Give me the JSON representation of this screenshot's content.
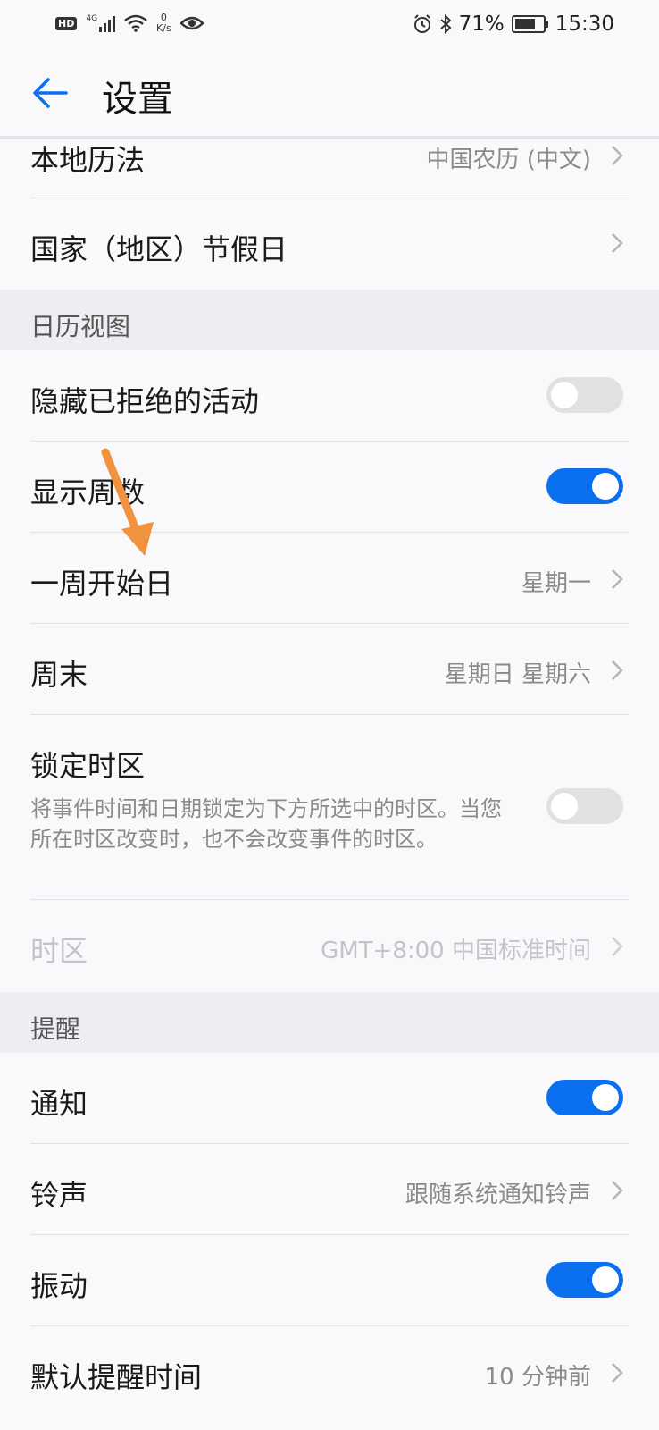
{
  "status_bar": {
    "hd": "HD",
    "network": "4G",
    "speed_value": "0",
    "speed_unit": "K/s",
    "battery": "71%",
    "time": "15:30"
  },
  "header": {
    "title": "设置"
  },
  "rows_top": [
    {
      "label": "本地历法",
      "value": "中国农历 (中文)"
    },
    {
      "label": "国家（地区）节假日",
      "value": ""
    }
  ],
  "section_calendar_view": {
    "title": "日历视图",
    "hide_declined": {
      "label": "隐藏已拒绝的活动",
      "on": false
    },
    "show_week_number": {
      "label": "显示周数",
      "on": true
    },
    "week_start": {
      "label": "一周开始日",
      "value": "星期一"
    },
    "weekend": {
      "label": "周末",
      "value": "星期日 星期六"
    },
    "lock_timezone": {
      "label": "锁定时区",
      "description": "将事件时间和日期锁定为下方所选中的时区。当您所在时区改变时，也不会改变事件的时区。",
      "on": false
    },
    "timezone": {
      "label": "时区",
      "value": "GMT+8:00 中国标准时间"
    }
  },
  "section_reminder": {
    "title": "提醒",
    "notification": {
      "label": "通知",
      "on": true
    },
    "ringtone": {
      "label": "铃声",
      "value": "跟随系统通知铃声"
    },
    "vibration": {
      "label": "振动",
      "on": true
    },
    "default_reminder": {
      "label": "默认提醒时间",
      "value": "10 分钟前"
    }
  },
  "colors": {
    "accent": "#0a70f0",
    "toggle_off": "#e1e1e3",
    "annotation_arrow": "#f0923e"
  }
}
